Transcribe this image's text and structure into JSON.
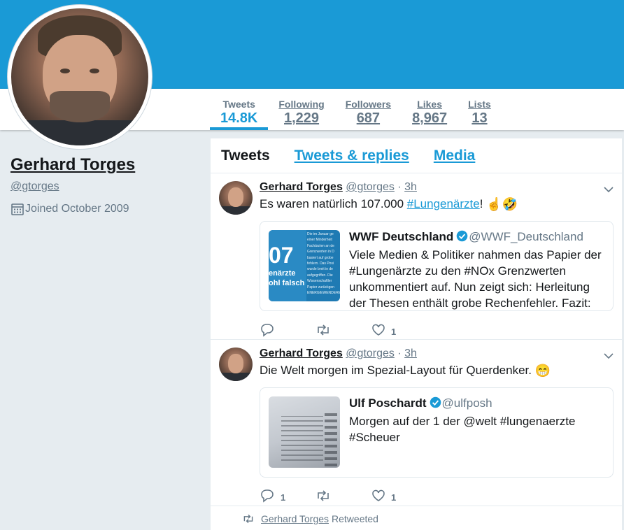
{
  "profile": {
    "name": "Gerhard Torges",
    "handle": "@gtorges",
    "joined": "Joined October 2009"
  },
  "stats": [
    {
      "label": "Tweets",
      "value": "14.8K"
    },
    {
      "label": "Following",
      "value": "1,229"
    },
    {
      "label": "Followers",
      "value": "687"
    },
    {
      "label": "Likes",
      "value": "8,967"
    },
    {
      "label": "Lists",
      "value": "13"
    }
  ],
  "tabs": [
    "Tweets",
    "Tweets & replies",
    "Media"
  ],
  "tweets": [
    {
      "author": "Gerhard Torges",
      "handle": "@gtorges",
      "sep": "·",
      "time": "3h",
      "text_before": "Es waren natürlich 107.000 ",
      "hashtag": "#Lungenärzte",
      "text_after": "! ",
      "emojis": "☝🤣",
      "quote": {
        "name": "WWF Deutschland",
        "handle": "@WWF_Deutschland",
        "body": "Viele Medien & Politiker nahmen das Papier der #Lungenärzte zu den #NOx Grenzwerten unkommentiert auf. Nun zeigt sich: Herleitung der Thesen enthält grobe Rechenfehler. Fazit:",
        "thumb_big": "07",
        "thumb_line1": "enärzte",
        "thumb_line2": "ohl falsch",
        "thumb_side": [
          "Die im Januar ge",
          "einer Minderheit",
          "Fachärzten an de",
          "Grenzwerten in D",
          "basiert auf grobe",
          "fehlern. Das Posi",
          "wurde breit in de",
          "aufgegriffen. Die",
          "Wissenschaftler",
          "Papier zurückgen",
          "ENERGIEWENDERES"
        ]
      },
      "replies": "",
      "retweets": "",
      "likes": "1"
    },
    {
      "author": "Gerhard Torges",
      "handle": "@gtorges",
      "sep": "·",
      "time": "3h",
      "text_before": "Die Welt morgen im Spezial-Layout für Querdenker. ",
      "emojis": "😁",
      "quote": {
        "name": "Ulf Poschardt",
        "handle": "@ulfposh",
        "body": "Morgen auf der 1 der @welt #lungenaerzte #Scheuer"
      },
      "replies": "1",
      "retweets": "",
      "likes": "1"
    }
  ],
  "retweeted_by": {
    "name": "Gerhard Torges",
    "suffix": "Retweeted"
  },
  "colors": {
    "accent": "#1a9ad6",
    "banner": "#1a9ad6",
    "muted": "#657786",
    "background": "#e6ecf0"
  }
}
